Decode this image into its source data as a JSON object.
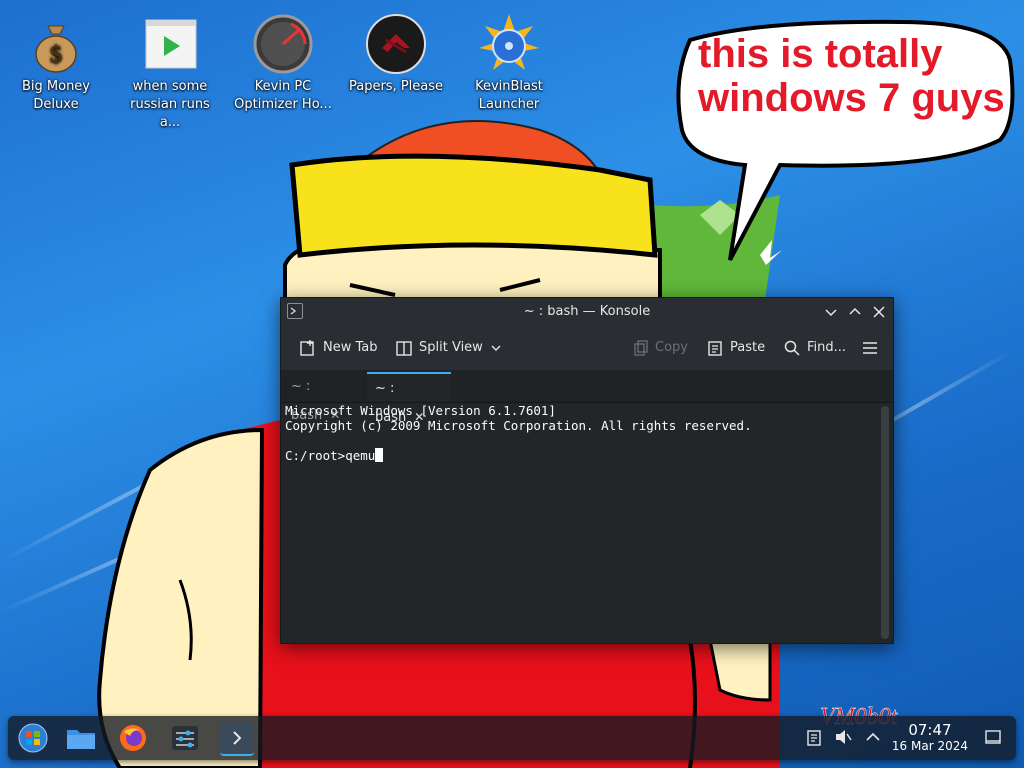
{
  "desktop": {
    "icons": [
      {
        "label_line1": "Big Money",
        "label_line2": "Deluxe",
        "icon": "money-bag-icon"
      },
      {
        "label_line1": "when some",
        "label_line2": "russian runs a...",
        "icon": "video-file-icon"
      },
      {
        "label_line1": "Kevin PC",
        "label_line2": "Optimizer Ho...",
        "icon": "speedometer-icon"
      },
      {
        "label_line1": "Papers, Please",
        "label_line2": "",
        "icon": "papers-please-icon"
      },
      {
        "label_line1": "KevinBlast",
        "label_line2": "Launcher",
        "icon": "disc-burn-icon"
      }
    ],
    "bubble": {
      "line1": "this is totally",
      "line2": "windows 7 guys"
    },
    "watermark": "VM0b0t"
  },
  "konsole": {
    "title": "~ : bash — Konsole",
    "toolbar": {
      "new_tab": "New Tab",
      "split_view": "Split View",
      "copy": "Copy",
      "paste": "Paste",
      "find": "Find..."
    },
    "tabs": [
      {
        "label": "~ : bash",
        "active": false
      },
      {
        "label": "~ : bash",
        "active": true
      }
    ],
    "terminal": {
      "line1": "Microsoft Windows [Version 6.1.7601]",
      "line2": "Copyright (c) 2009 Microsoft Corporation. All rights reserved.",
      "line3": "",
      "prompt": "C:/root>qemu"
    }
  },
  "taskbar": {
    "apps": [
      "start-orb-icon",
      "file-manager-icon",
      "firefox-icon",
      "system-settings-icon",
      "konsole-icon"
    ],
    "clock": {
      "time": "07:47",
      "date": "16 Mar 2024"
    }
  },
  "colors": {
    "accent": "#3daee9",
    "bubble_text": "#e31a2a",
    "hat": "#f7e21b",
    "shirt": "#e8101a"
  }
}
